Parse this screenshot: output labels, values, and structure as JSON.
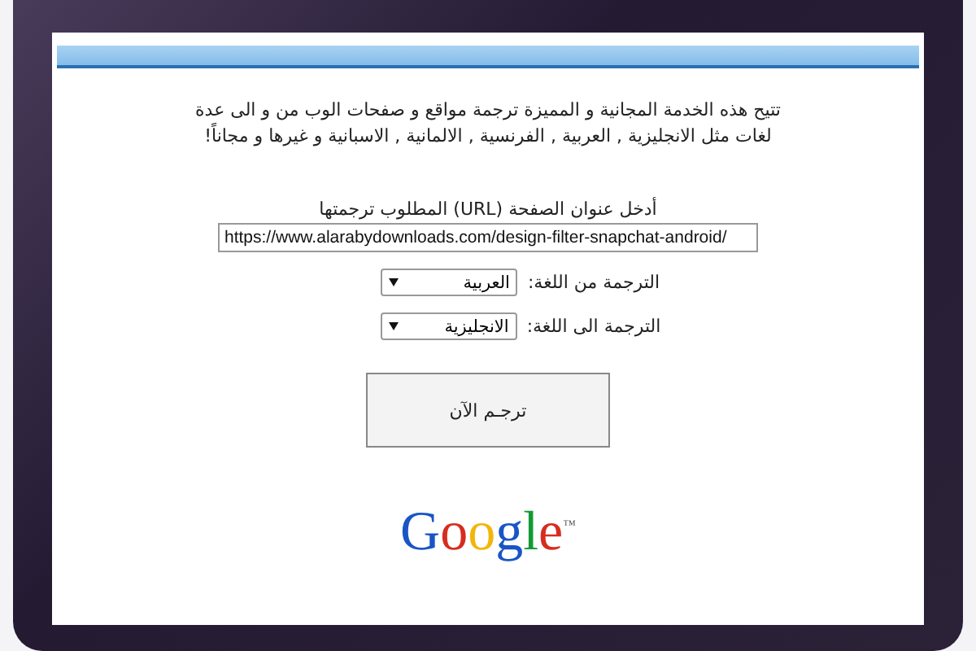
{
  "intro": "تتيح هذه الخدمة المجانية و المميزة ترجمة مواقع و صفحات الوب من و الى عدة لغات مثل الانجليزية , العربية , الفرنسية , الالمانية , الاسبانية و غيرها و مجاناً!",
  "url_field": {
    "label": "أدخل عنوان الصفحة (URL) المطلوب ترجمتها",
    "value": "https://www.alarabydownloads.com/design-filter-snapchat-android/"
  },
  "language_selects": [
    {
      "label": "الترجمة من اللغة:",
      "value": "العربية"
    },
    {
      "label": "الترجمة الى اللغة:",
      "value": "الانجليزية"
    }
  ],
  "translate_button": "ترجـم الآن",
  "logo": {
    "text": "Google",
    "mark": "™"
  }
}
